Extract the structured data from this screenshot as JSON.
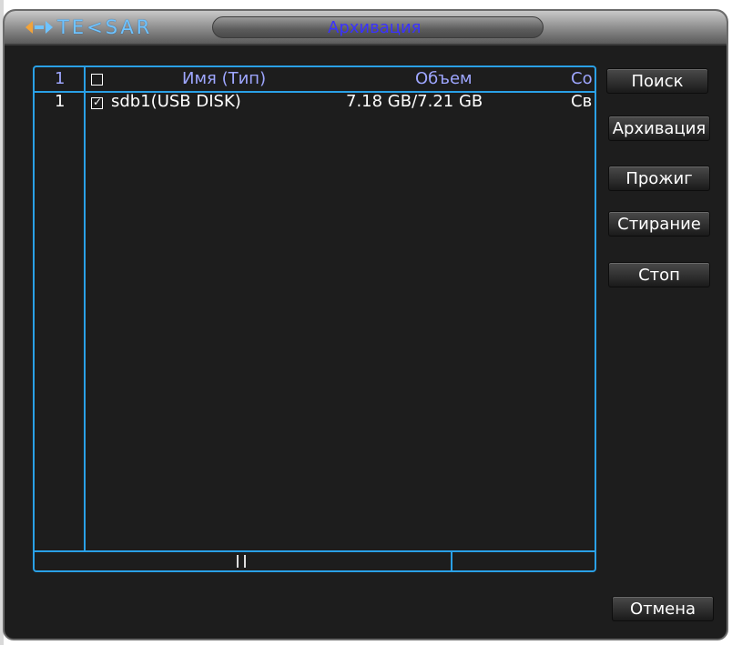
{
  "window": {
    "brand": "TE<SAR",
    "title": "Архивация"
  },
  "table": {
    "headers": {
      "index": "1",
      "name": "Имя (Тип)",
      "volume": "Объем",
      "status": "Со"
    },
    "rows": [
      {
        "index": "1",
        "checked": true,
        "name": "sdb1(USB DISK)",
        "volume": "7.18 GB/7.21 GB",
        "status": "Св"
      }
    ]
  },
  "buttons": {
    "search": "Поиск",
    "archive": "Архивация",
    "burn": "Прожиг",
    "erase": "Стирание",
    "stop": "Стоп",
    "cancel": "Отмена"
  },
  "colors": {
    "accent": "#2aa0e6",
    "header_text": "#9ea6ff",
    "title_text": "#3a32ff",
    "background": "#1d1d1d"
  },
  "icons": [
    "logo-arrows-icon",
    "checkbox-icon",
    "checkbox-checked-icon"
  ]
}
